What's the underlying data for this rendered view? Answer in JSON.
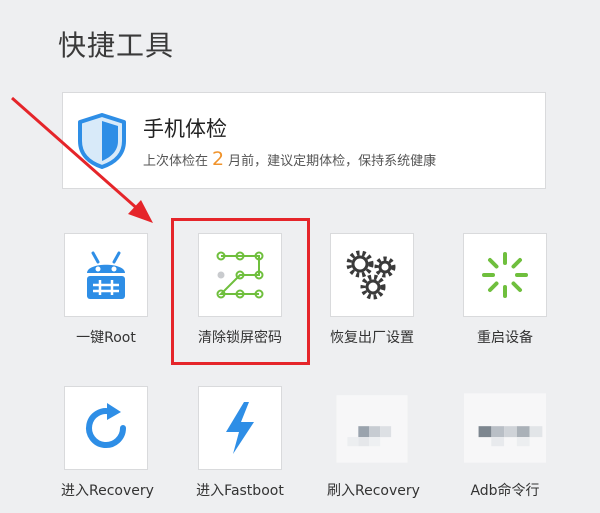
{
  "page_title": "快捷工具",
  "checkup": {
    "icon": "shield-icon",
    "title": "手机体检",
    "sub_before": "上次体检在",
    "months": "2",
    "sub_after": "月前，建议定期体检，保持系统健康"
  },
  "tools": [
    {
      "label": "一键Root",
      "icon": "android-root-icon"
    },
    {
      "label": "清除锁屏密码",
      "icon": "pattern-lock-icon"
    },
    {
      "label": "恢复出厂设置",
      "icon": "gears-icon"
    },
    {
      "label": "重启设备",
      "icon": "restart-spinner-icon"
    },
    {
      "label": "进入Recovery",
      "icon": "refresh-icon"
    },
    {
      "label": "进入Fastboot",
      "icon": "lightning-icon"
    },
    {
      "label": "刷入Recovery",
      "icon": "flash-recovery-icon"
    },
    {
      "label": "Adb命令行",
      "icon": "adb-terminal-icon"
    }
  ],
  "colors": {
    "accent_blue": "#2e8ee6",
    "accent_green": "#6fbf3d",
    "gear_dark": "#3a3a3a",
    "highlight_red": "#e5252a",
    "months_orange": "#f0932b"
  }
}
